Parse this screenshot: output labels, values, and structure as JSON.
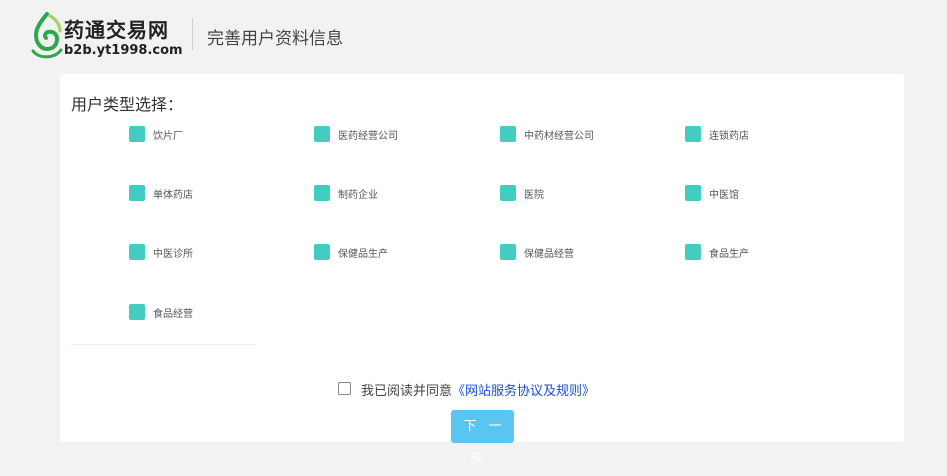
{
  "header": {
    "logo_name": "药通交易网",
    "logo_url": "b2b.yt1998.com",
    "page_title": "完善用户资料信息",
    "brand_color": "#2aa84a"
  },
  "form": {
    "section_title": "用户类型选择：",
    "checkbox_color": "#43cdc0",
    "options": [
      "饮片厂",
      "医药经营公司",
      "中药材经营公司",
      "连锁药店",
      "单体药店",
      "制药企业",
      "医院",
      "中医馆",
      "中医诊所",
      "保健品生产",
      "保健品经营",
      "食品生产",
      "食品经营"
    ],
    "agreement": {
      "text": "我已阅读并同意",
      "link": "《网站服务协议及规则》",
      "link_color": "#1a4fd6",
      "checked": false
    },
    "next_button": "下一步",
    "button_color": "#5bc5f2"
  }
}
